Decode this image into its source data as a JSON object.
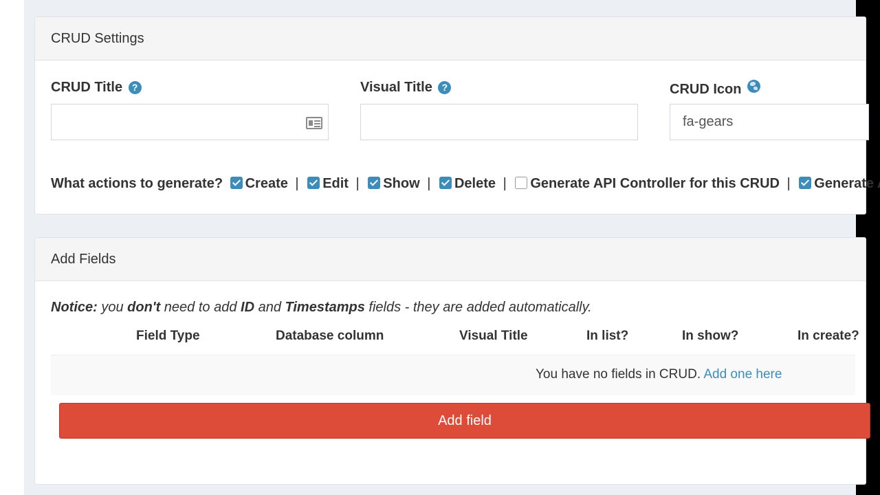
{
  "crud_settings": {
    "heading": "CRUD Settings",
    "crud_title": {
      "label": "CRUD Title",
      "help_icon": "question-circle-icon",
      "value": "",
      "addon_icon": "id-card-icon"
    },
    "visual_title": {
      "label": "Visual Title",
      "help_icon": "question-circle-icon",
      "value": ""
    },
    "crud_icon": {
      "label": "CRUD Icon",
      "help_icon": "globe-icon",
      "value": "fa-gears"
    },
    "actions": {
      "label": "What actions to generate?",
      "separator": "|",
      "items": [
        {
          "label": "Create",
          "checked": true
        },
        {
          "label": "Edit",
          "checked": true
        },
        {
          "label": "Show",
          "checked": true
        },
        {
          "label": "Delete",
          "checked": true
        },
        {
          "label": "Generate API Controller for this CRUD",
          "checked": false
        },
        {
          "label": "Generate AJAX",
          "checked": true
        }
      ]
    }
  },
  "add_fields": {
    "heading": "Add Fields",
    "notice": {
      "prefix": "Notice:",
      "part1": " you ",
      "strong1": "don't",
      "part2": " need to add ",
      "strong2": "ID",
      "part3": " and ",
      "strong3": "Timestamps",
      "part4": " fields - they are added automatically."
    },
    "columns": [
      "Field Type",
      "Database column",
      "Visual Title",
      "In list?",
      "In show?",
      "In create?"
    ],
    "empty_message": "You have no fields in CRUD.",
    "empty_link": "Add one here",
    "add_button": "Add field"
  },
  "colors": {
    "accent": "#3c8dbc",
    "danger": "#dd4b39",
    "page_bg": "#ecf0f5"
  }
}
